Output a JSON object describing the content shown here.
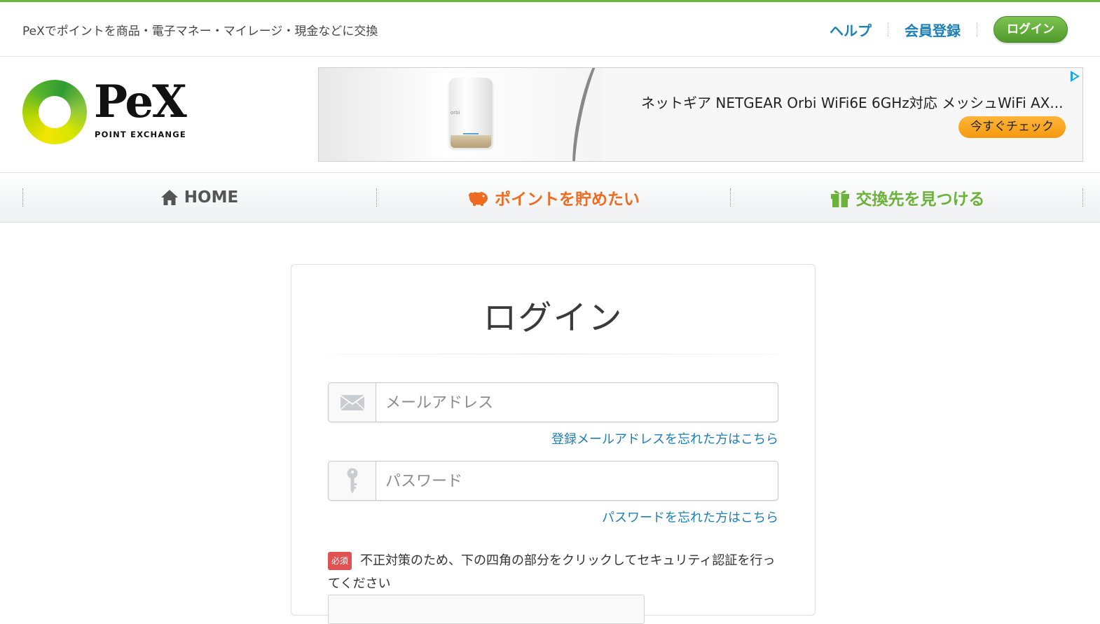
{
  "header": {
    "tagline": "PeXでポイントを商品・電子マネー・マイレージ・現金などに交換",
    "links": {
      "help": "ヘルプ",
      "register": "会員登録",
      "login": "ログイン"
    }
  },
  "logo": {
    "name": "PeX",
    "subtitle": "POINT EXCHANGE"
  },
  "ad": {
    "text": "ネットギア NETGEAR Orbi WiFi6E 6GHz対応 メッシュWiFi AX...",
    "button": "今すぐチェック",
    "product_label": "orbi"
  },
  "nav": {
    "home": "HOME",
    "save": "ポイントを貯めたい",
    "exchange": "交換先を見つける"
  },
  "login": {
    "title": "ログイン",
    "email_placeholder": "メールアドレス",
    "forgot_email": "登録メールアドレスを忘れた方はこちら",
    "password_placeholder": "パスワード",
    "forgot_password": "パスワードを忘れた方はこちら",
    "required_badge": "必須",
    "captcha_text": "不正対策のため、下の四角の部分をクリックしてセキュリティ認証を行ってください"
  },
  "colors": {
    "brand_green": "#6db33f",
    "link_blue": "#1d7fb6",
    "nav_orange": "#f06b22",
    "nav_green": "#6bb23a",
    "required_red": "#e05252"
  }
}
